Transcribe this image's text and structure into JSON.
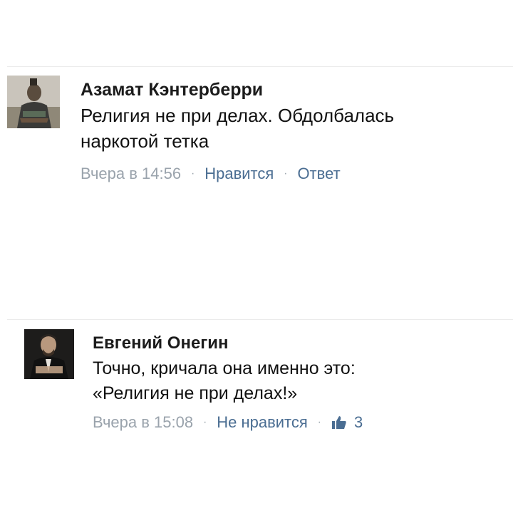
{
  "comments": [
    {
      "author": "Азамат Кэнтерберри",
      "text_lines": [
        "Религия не при делах. Обдолбалась",
        "наркотой тетка"
      ],
      "time": "Вчера в 14:56",
      "like_label": "Нравится",
      "reply_label": "Ответ",
      "avatar_icon": "samurai-avatar-icon"
    },
    {
      "author": "Евгений Онегин",
      "text_lines": [
        "Точно, кричала она именно это:",
        "«Религия не при делах!»"
      ],
      "time": "Вчера в 15:08",
      "like_label": "Не нравится",
      "like_count": "3",
      "avatar_icon": "man-avatar-icon"
    }
  ],
  "separator": "·",
  "colors": {
    "link": "#4a6d92",
    "meta": "#9aa3ac",
    "divider": "#ebebeb"
  }
}
